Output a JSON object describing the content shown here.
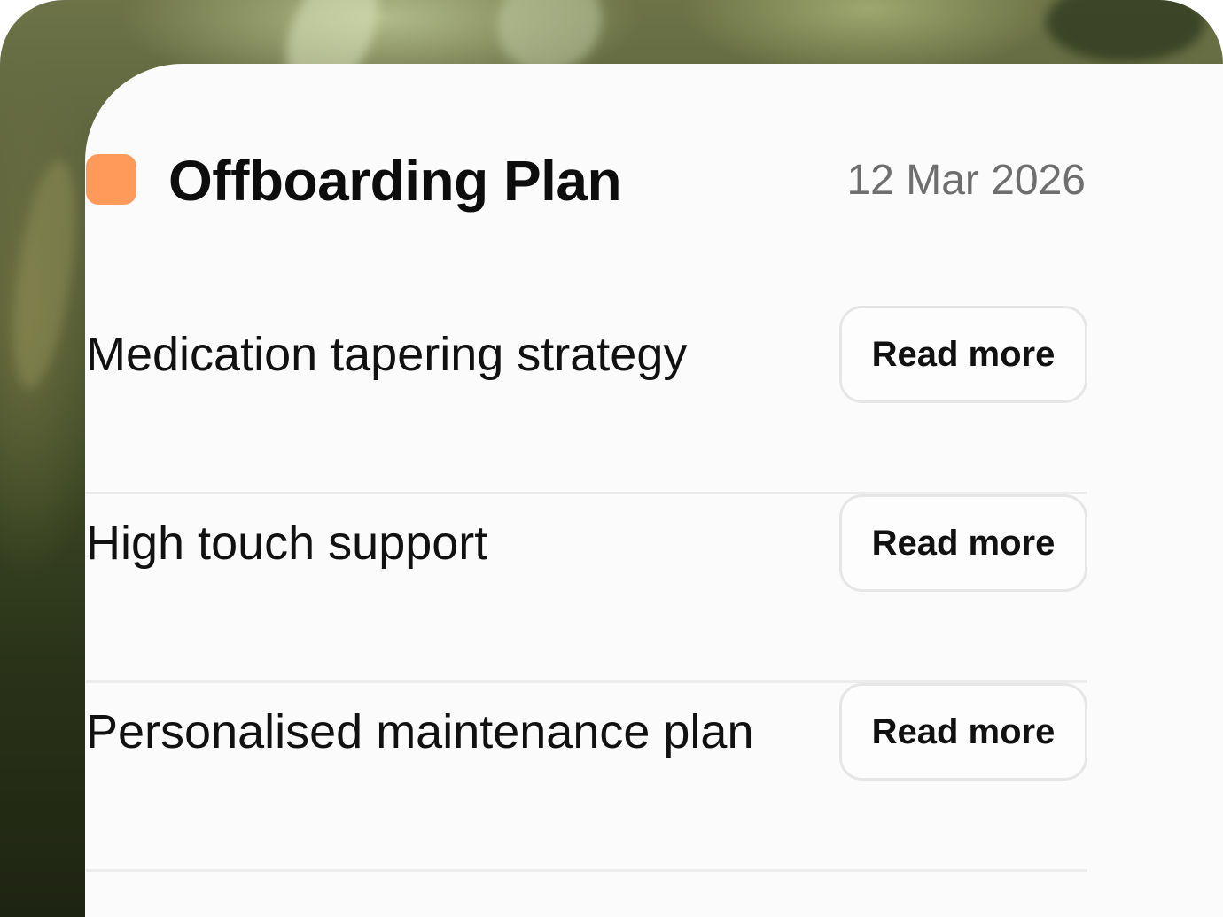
{
  "plan": {
    "title": "Offboarding Plan",
    "date": "12 Mar 2026",
    "badge_color": "#ff9a5a",
    "items": [
      {
        "label": "Medication tapering strategy",
        "action": "Read more"
      },
      {
        "label": "High touch support",
        "action": "Read more"
      },
      {
        "label": "Personalised maintenance plan",
        "action": "Read more"
      }
    ]
  }
}
